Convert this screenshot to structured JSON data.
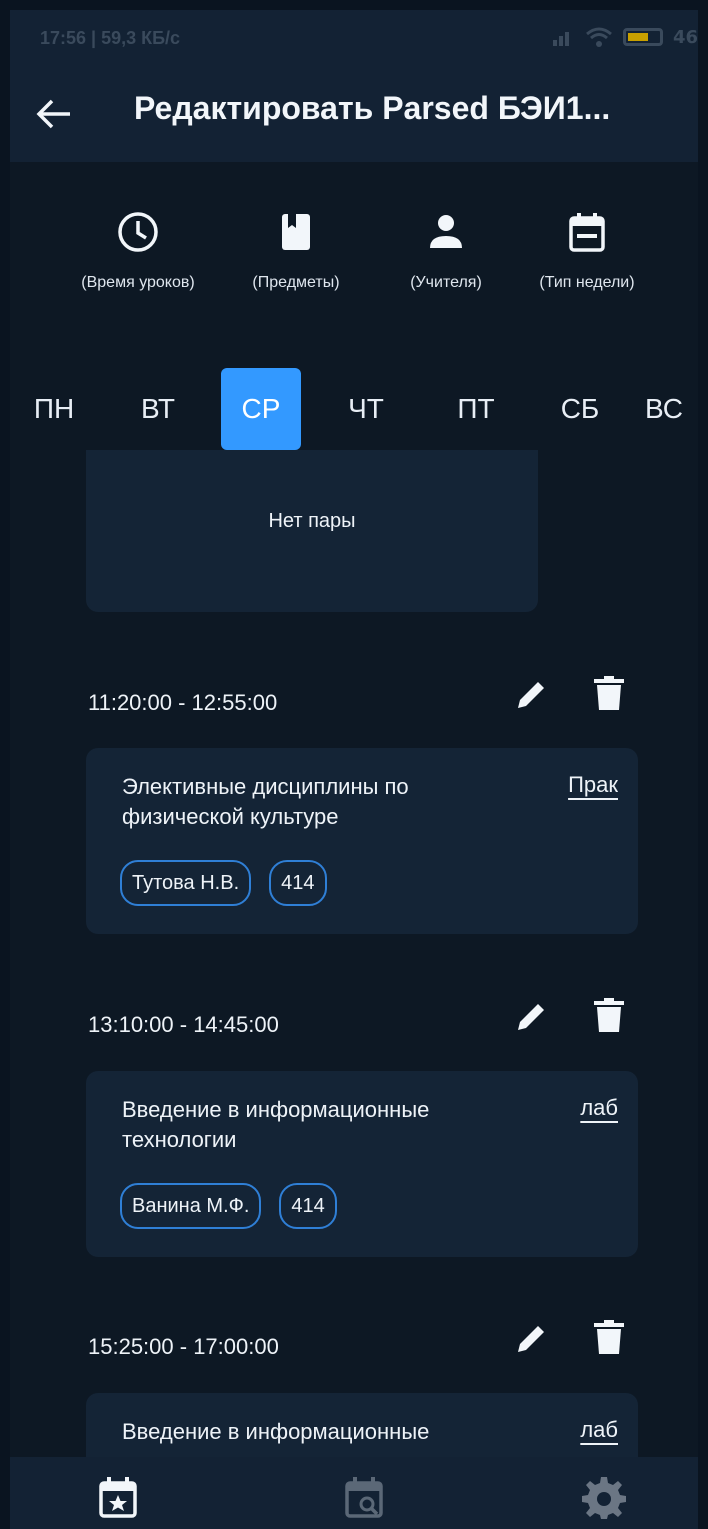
{
  "status_bar": {
    "time_text": "17:56 | 59,3 КБ/с",
    "network_label": "46"
  },
  "app_bar": {
    "back_icon": "arrow-left-icon",
    "title": "Редактировать Parsed БЭИ1..."
  },
  "toolbar": [
    {
      "icon": "clock-icon",
      "label": "(Время уроков)"
    },
    {
      "icon": "book-icon",
      "label": "(Предметы)"
    },
    {
      "icon": "person-icon",
      "label": "(Учителя)"
    },
    {
      "icon": "calendar-icon",
      "label": "(Тип недели)"
    }
  ],
  "days": [
    {
      "label": "ПН",
      "active": false
    },
    {
      "label": "ВТ",
      "active": false
    },
    {
      "label": "СР",
      "active": true
    },
    {
      "label": "ЧТ",
      "active": false
    },
    {
      "label": "ПТ",
      "active": false
    },
    {
      "label": "СБ",
      "active": false
    },
    {
      "label": "ВС",
      "active": false
    }
  ],
  "empty_slot": {
    "text": "Нет пары"
  },
  "lessons": [
    {
      "time": "11:20:00 - 12:55:00",
      "subject": "Элективные дисциплины по физической культуре",
      "type": "Прак",
      "teacher": "Тутова Н.В.",
      "room": "414"
    },
    {
      "time": "13:10:00 - 14:45:00",
      "subject": "Введение в информационные технологии",
      "type": "лаб",
      "teacher": "Ванина М.Ф.",
      "room": "414"
    },
    {
      "time": "15:25:00 - 17:00:00",
      "subject": "Введение в информационные",
      "type": "лаб"
    }
  ],
  "bottom_nav": [
    {
      "icon": "calendar-star-icon"
    },
    {
      "icon": "calendar-search-icon"
    },
    {
      "icon": "gear-icon"
    }
  ],
  "colors": {
    "background": "#0d1824",
    "surface": "#142436",
    "accent": "#3399ff",
    "chip_border": "#2f7fd6"
  }
}
